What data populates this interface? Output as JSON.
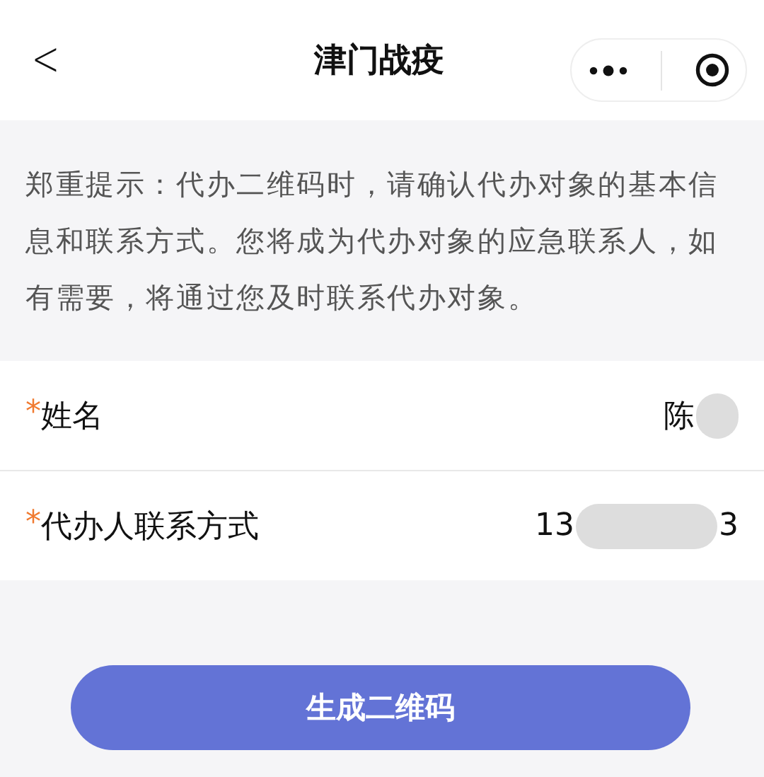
{
  "nav": {
    "back": "<",
    "title": "津门战疫"
  },
  "notice": "郑重提示：代办二维码时，请确认代办对象的基本信息和联系方式。您将成为代办对象的应急联系人，如有需要，将通过您及时联系代办对象。",
  "fields": [
    {
      "required_mark": "*",
      "label": "姓名",
      "value_parts": [
        "陈"
      ],
      "redacted": true
    },
    {
      "required_mark": "*",
      "label": "代办人联系方式",
      "value_parts": [
        "13",
        "3"
      ],
      "redacted": true
    }
  ],
  "submit": "生成二维码"
}
